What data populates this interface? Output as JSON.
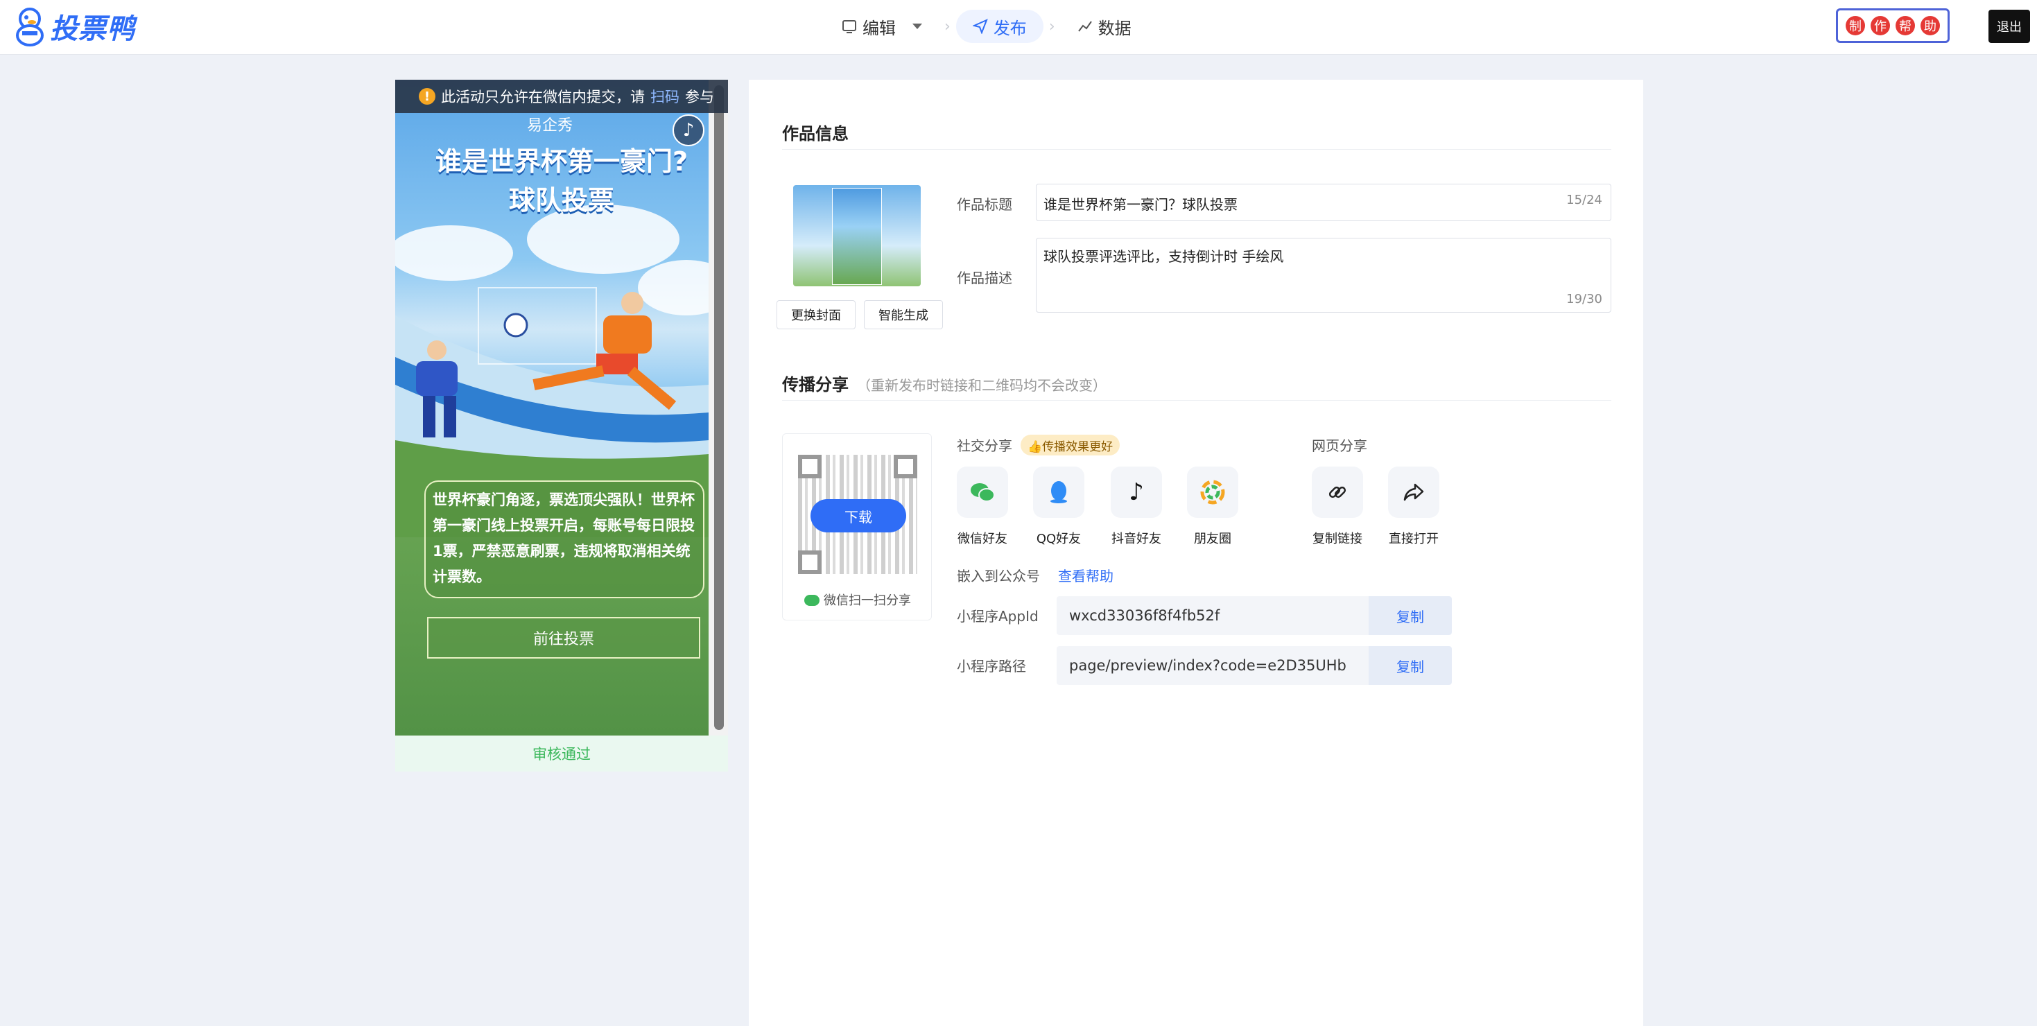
{
  "app": {
    "logo_text": "投票鸭",
    "exit_label": "退出",
    "help_chars": [
      "制",
      "作",
      "帮",
      "助"
    ]
  },
  "nav": {
    "edit": "编辑",
    "publish": "发布",
    "data": "数据"
  },
  "preview": {
    "notice_prefix": "此活动只允许在微信内提交，请",
    "notice_link": "扫码",
    "notice_suffix": "参与",
    "brand": "易企秀",
    "title_line1": "谁是世界杯第一豪门?",
    "title_line2": "球队投票",
    "description": "世界杯豪门角逐，票选顶尖强队！世界杯第一豪门线上投票开启，每账号每日限投1票，严禁恶意刷票，违规将取消相关统计票数。",
    "vote_button": "前往投票",
    "review_status": "审核通过"
  },
  "work_info": {
    "section_title": "作品信息",
    "replace_cover": "更换封面",
    "smart_generate": "智能生成",
    "title_label": "作品标题",
    "title_value": "谁是世界杯第一豪门？球队投票",
    "title_count": "15/24",
    "desc_label": "作品描述",
    "desc_value": "球队投票评选评比，支持倒计时  手绘风",
    "desc_count": "19/30"
  },
  "share": {
    "section_title": "传播分享",
    "section_note": "（重新发布时链接和二维码均不会改变）",
    "download": "下载",
    "qr_tip": "微信扫一扫分享",
    "social_label": "社交分享",
    "social_badge": "👍传播效果更好",
    "web_label": "网页分享",
    "items": [
      "微信好友",
      "QQ好友",
      "抖音好友",
      "朋友圈"
    ],
    "web_items": [
      "复制链接",
      "直接打开"
    ],
    "embed_label": "嵌入到公众号",
    "embed_help": "查看帮助",
    "appid_label": "小程序AppId",
    "appid_value": "wxcd33036f8f4fb52f",
    "path_label": "小程序路径",
    "path_value": "page/preview/index?code=e2D35UHb",
    "copy": "复制"
  },
  "colors": {
    "accent": "#2f6df6",
    "success": "#3cb85c"
  },
  "icons": [
    "wechat-icon",
    "qq-icon",
    "douyin-icon",
    "moments-icon",
    "link-icon",
    "share-icon",
    "music-icon",
    "warning-icon"
  ]
}
